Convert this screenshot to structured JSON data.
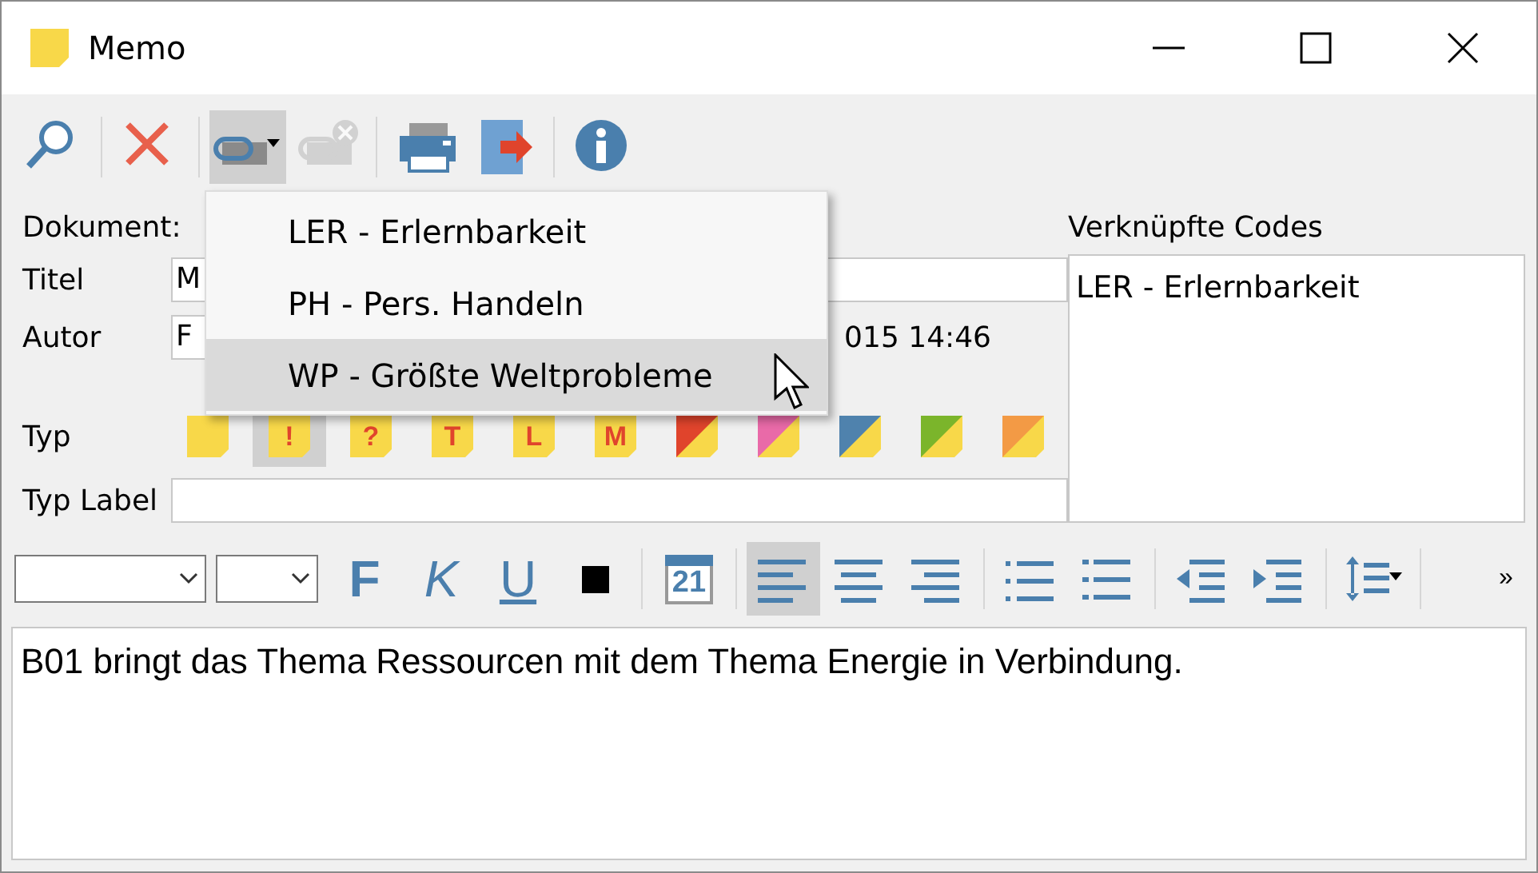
{
  "window": {
    "title": "Memo"
  },
  "toolbar": [
    {
      "kind": "search",
      "pressed": false,
      "disabled": false
    },
    {
      "kind": "delete",
      "pressed": false,
      "disabled": false
    },
    {
      "kind": "link",
      "pressed": true,
      "disabled": false
    },
    {
      "kind": "unlink",
      "pressed": false,
      "disabled": true
    },
    {
      "kind": "print",
      "pressed": false,
      "disabled": false
    },
    {
      "kind": "export",
      "pressed": false,
      "disabled": false
    },
    {
      "kind": "info",
      "pressed": false,
      "disabled": false
    }
  ],
  "form": {
    "document_label": "Dokument:",
    "title_label": "Titel",
    "title_value": "M",
    "author_label": "Autor",
    "author_value": "F",
    "date": "015 14:46",
    "type_label": "Typ",
    "type_label_label": "Typ Label",
    "types": [
      {
        "color": "#f8d849",
        "selected": false
      },
      {
        "glyph": "!",
        "color": "#f8d849",
        "selected": true
      },
      {
        "glyph": "?",
        "color": "#f8d849",
        "selected": false
      },
      {
        "glyph": "T",
        "color": "#f8d849",
        "selected": false
      },
      {
        "glyph": "L",
        "color": "#f8d849",
        "selected": false
      },
      {
        "glyph": "M",
        "color": "#f8d849",
        "selected": false
      },
      {
        "color": "#e0442c",
        "selected": false
      },
      {
        "color": "#e96aa8",
        "selected": false
      },
      {
        "color": "#4f82ad",
        "selected": false
      },
      {
        "color": "#7bb52b",
        "selected": false
      },
      {
        "color": "#f39a45",
        "selected": false
      }
    ]
  },
  "codes": {
    "title": "Verknüpfte Codes",
    "items": [
      "LER - Erlernbarkeit"
    ]
  },
  "format_toolbar": [
    {
      "kind": "select"
    },
    {
      "kind": "select-small"
    },
    {
      "kind": "bold",
      "label": "F",
      "selected": false
    },
    {
      "kind": "italic",
      "label": "K",
      "selected": false
    },
    {
      "kind": "underline",
      "label": "U",
      "selected": false
    },
    {
      "kind": "color",
      "color": "#000000"
    },
    {
      "kind": "sep"
    },
    {
      "kind": "calendar",
      "label": "21"
    },
    {
      "kind": "sep"
    },
    {
      "kind": "align-left",
      "selected": true
    },
    {
      "kind": "align-center",
      "selected": false
    },
    {
      "kind": "align-right",
      "selected": false
    },
    {
      "kind": "sep"
    },
    {
      "kind": "bullets",
      "selected": false
    },
    {
      "kind": "numbers",
      "selected": false
    },
    {
      "kind": "sep"
    },
    {
      "kind": "outdent",
      "selected": false
    },
    {
      "kind": "indent",
      "selected": false
    },
    {
      "kind": "sep"
    },
    {
      "kind": "spacing",
      "selected": false
    },
    {
      "kind": "sep"
    },
    {
      "kind": "more",
      "label": "»"
    }
  ],
  "editor": {
    "text": "B01 bringt das Thema Ressourcen mit dem Thema Energie in Verbindung."
  },
  "menu": [
    {
      "label": "LER - Erlernbarkeit",
      "selected": false
    },
    {
      "label": "PH - Pers. Handeln",
      "selected": false
    },
    {
      "label": "WP - Größte Weltprobleme",
      "selected": true
    }
  ]
}
